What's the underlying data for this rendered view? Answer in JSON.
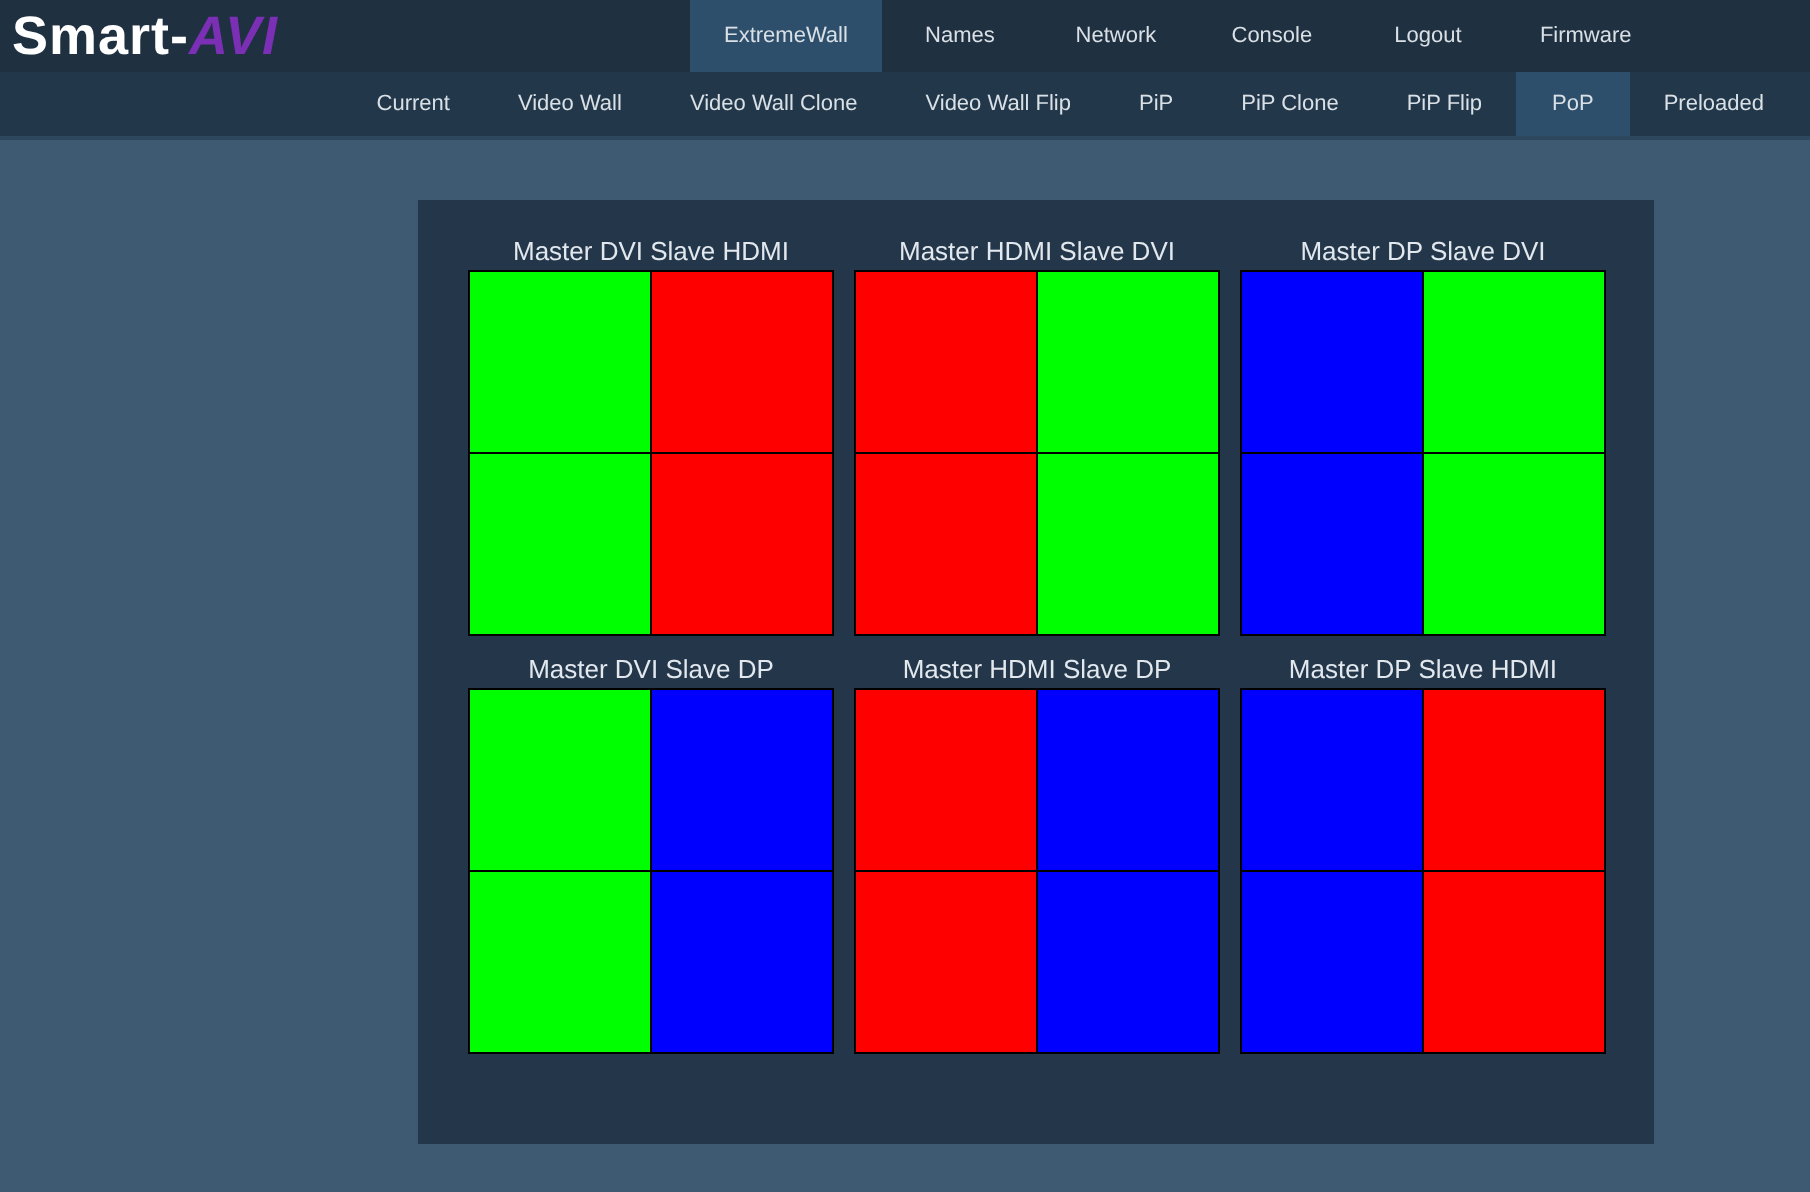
{
  "logo": {
    "text": "Smart-",
    "mark": "AVI"
  },
  "main_nav": [
    {
      "label": "ExtremeWall",
      "selected": true
    },
    {
      "label": "Names",
      "selected": false
    },
    {
      "label": "Network",
      "selected": false
    },
    {
      "label": "Console",
      "selected": false
    },
    {
      "label": "Logout",
      "selected": false
    },
    {
      "label": "Firmware",
      "selected": false
    }
  ],
  "sub_nav": [
    {
      "label": "Current",
      "selected": false
    },
    {
      "label": "Video Wall",
      "selected": false
    },
    {
      "label": "Video Wall Clone",
      "selected": false
    },
    {
      "label": "Video Wall Flip",
      "selected": false
    },
    {
      "label": "PiP",
      "selected": false
    },
    {
      "label": "PiP Clone",
      "selected": false
    },
    {
      "label": "PiP Flip",
      "selected": false
    },
    {
      "label": "PoP",
      "selected": true
    },
    {
      "label": "Preloaded",
      "selected": false
    }
  ],
  "presets": [
    {
      "title": "Master DVI Slave HDMI",
      "cells": [
        {
          "color": "#00ff00"
        },
        {
          "color": "#ff0000"
        },
        {
          "color": "#00ff00"
        },
        {
          "color": "#ff0000"
        }
      ]
    },
    {
      "title": "Master HDMI Slave DVI",
      "cells": [
        {
          "color": "#ff0000"
        },
        {
          "color": "#00ff00"
        },
        {
          "color": "#ff0000"
        },
        {
          "color": "#00ff00"
        }
      ]
    },
    {
      "title": "Master DP Slave DVI",
      "cells": [
        {
          "color": "#0000ff"
        },
        {
          "color": "#00ff00"
        },
        {
          "color": "#0000ff"
        },
        {
          "color": "#00ff00"
        }
      ]
    },
    {
      "title": "Master DVI Slave DP",
      "cells": [
        {
          "color": "#00ff00"
        },
        {
          "color": "#0000ff"
        },
        {
          "color": "#00ff00"
        },
        {
          "color": "#0000ff"
        }
      ]
    },
    {
      "title": "Master HDMI Slave DP",
      "cells": [
        {
          "color": "#ff0000"
        },
        {
          "color": "#0000ff"
        },
        {
          "color": "#ff0000"
        },
        {
          "color": "#0000ff"
        }
      ]
    },
    {
      "title": "Master DP Slave HDMI",
      "cells": [
        {
          "color": "#0000ff"
        },
        {
          "color": "#ff0000"
        },
        {
          "color": "#0000ff"
        },
        {
          "color": "#ff0000"
        }
      ]
    }
  ]
}
